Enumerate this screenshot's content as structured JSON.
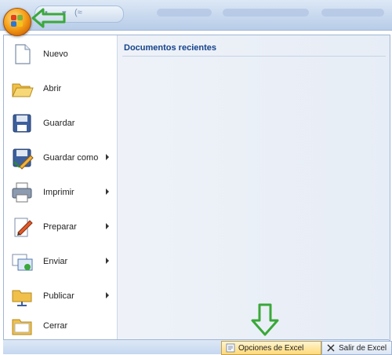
{
  "quick_access": {
    "glyph_1": "▾",
    "glyph_2": "(≈"
  },
  "menu": {
    "items": [
      {
        "label": "Nuevo",
        "icon": "new-document-icon",
        "has_submenu": false
      },
      {
        "label": "Abrir",
        "icon": "open-folder-icon",
        "has_submenu": false
      },
      {
        "label": "Guardar",
        "icon": "save-disk-icon",
        "has_submenu": false
      },
      {
        "label": "Guardar como",
        "icon": "save-as-icon",
        "has_submenu": true
      },
      {
        "label": "Imprimir",
        "icon": "printer-icon",
        "has_submenu": true
      },
      {
        "label": "Preparar",
        "icon": "prepare-pencil-icon",
        "has_submenu": true
      },
      {
        "label": "Enviar",
        "icon": "send-icon",
        "has_submenu": true
      },
      {
        "label": "Publicar",
        "icon": "publish-folder-icon",
        "has_submenu": true
      },
      {
        "label": "Cerrar",
        "icon": "close-folder-icon",
        "has_submenu": false
      }
    ]
  },
  "recent": {
    "title": "Documentos recientes"
  },
  "bottom": {
    "options_label": "Opciones de Excel",
    "exit_label": "Salir de Excel"
  },
  "colors": {
    "arrow_green": "#3aa83a",
    "office_orange": "#f7a21a",
    "accent_blue": "#15428b"
  }
}
